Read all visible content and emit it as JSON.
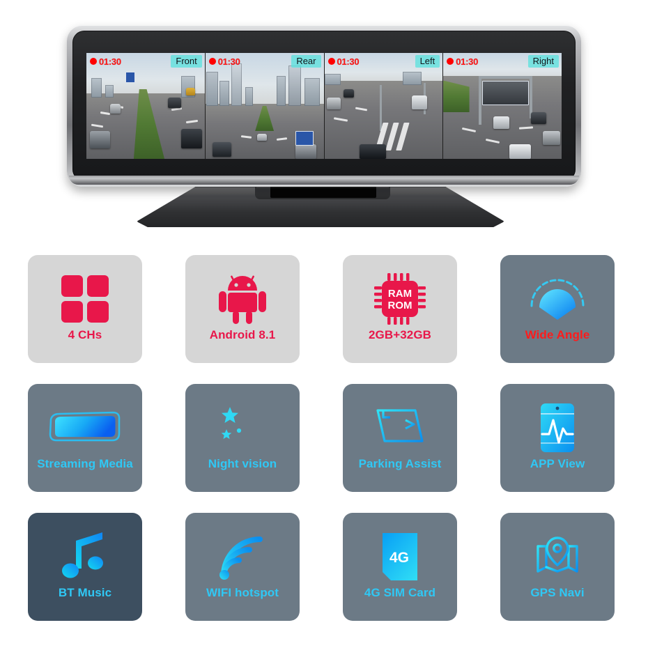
{
  "hero": {
    "device_name": "4-channel dashcam rearview mirror",
    "cameras": [
      {
        "id": "front",
        "tag": "Front",
        "time": "01:30",
        "rec_icon": "record-dot-icon"
      },
      {
        "id": "rear",
        "tag": "Rear",
        "time": "01:30",
        "rec_icon": "record-dot-icon"
      },
      {
        "id": "left",
        "tag": "Left",
        "time": "01:30",
        "rec_icon": "record-dot-icon"
      },
      {
        "id": "right",
        "tag": "Right",
        "time": "01:30",
        "rec_icon": "record-dot-icon"
      }
    ]
  },
  "colors": {
    "accent_red": "#e8174a",
    "accent_red_bright": "#ff1b1b",
    "accent_cyan": "#2fc8f5",
    "card_light_bg": "#d6d6d6",
    "card_slate_bg": "#6c7a86",
    "card_dark_bg": "#3d4f60",
    "osd_tag_bg": "#5ee2de",
    "osd_text": "#ff1212"
  },
  "features": [
    {
      "label": "4 CHs",
      "icon": "four-squares-grid-icon",
      "theme": "light"
    },
    {
      "label": "Android 8.1",
      "icon": "android-robot-icon",
      "theme": "light"
    },
    {
      "label": "2GB+32GB",
      "icon": "memory-chip-icon",
      "theme": "light",
      "chip_text_top": "RAM",
      "chip_text_bottom": "ROM"
    },
    {
      "label": "Wide Angle",
      "icon": "wide-angle-arc-icon",
      "theme": "slate-red"
    },
    {
      "label": "Streaming Media",
      "icon": "rearview-mirror-icon",
      "theme": "slate"
    },
    {
      "label": "Night vision",
      "icon": "moon-stars-icon",
      "theme": "slate"
    },
    {
      "label": "Parking Assist",
      "icon": "parking-guideline-icon",
      "theme": "slate"
    },
    {
      "label": "APP View",
      "icon": "phone-waveform-icon",
      "theme": "slate"
    },
    {
      "label": "BT Music",
      "icon": "music-note-icon",
      "theme": "dark"
    },
    {
      "label": "WIFI hotspot",
      "icon": "wifi-signal-icon",
      "theme": "slate"
    },
    {
      "label": "4G SIM Card",
      "icon": "sim-card-4g-icon",
      "theme": "slate",
      "badge_text": "4G"
    },
    {
      "label": "GPS Navi",
      "icon": "map-pin-icon",
      "theme": "slate"
    }
  ]
}
